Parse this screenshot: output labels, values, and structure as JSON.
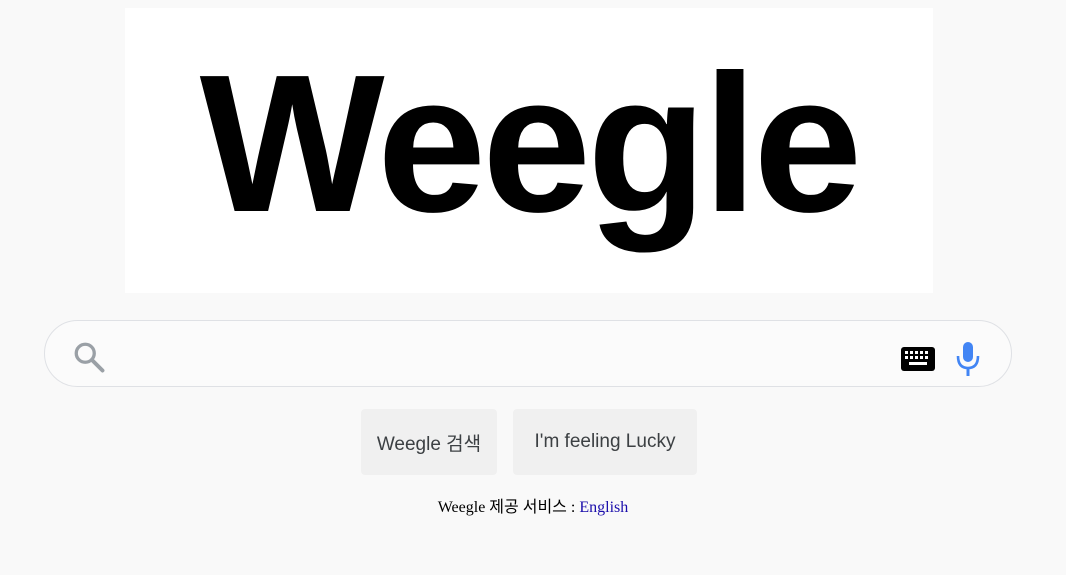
{
  "logo": {
    "text": "Weegle"
  },
  "search": {
    "value": "",
    "placeholder": ""
  },
  "icons": {
    "search": "search-icon",
    "keyboard": "keyboard-icon",
    "mic": "mic-icon"
  },
  "buttons": {
    "search_label": "Weegle 검색",
    "lucky_label": "I'm feeling Lucky"
  },
  "footer": {
    "offered_text": "Weegle 제공 서비스 :",
    "language_link": "English"
  },
  "colors": {
    "background": "#f9f9f9",
    "mic_blue": "#4285f4",
    "link": "#1a0dab"
  }
}
